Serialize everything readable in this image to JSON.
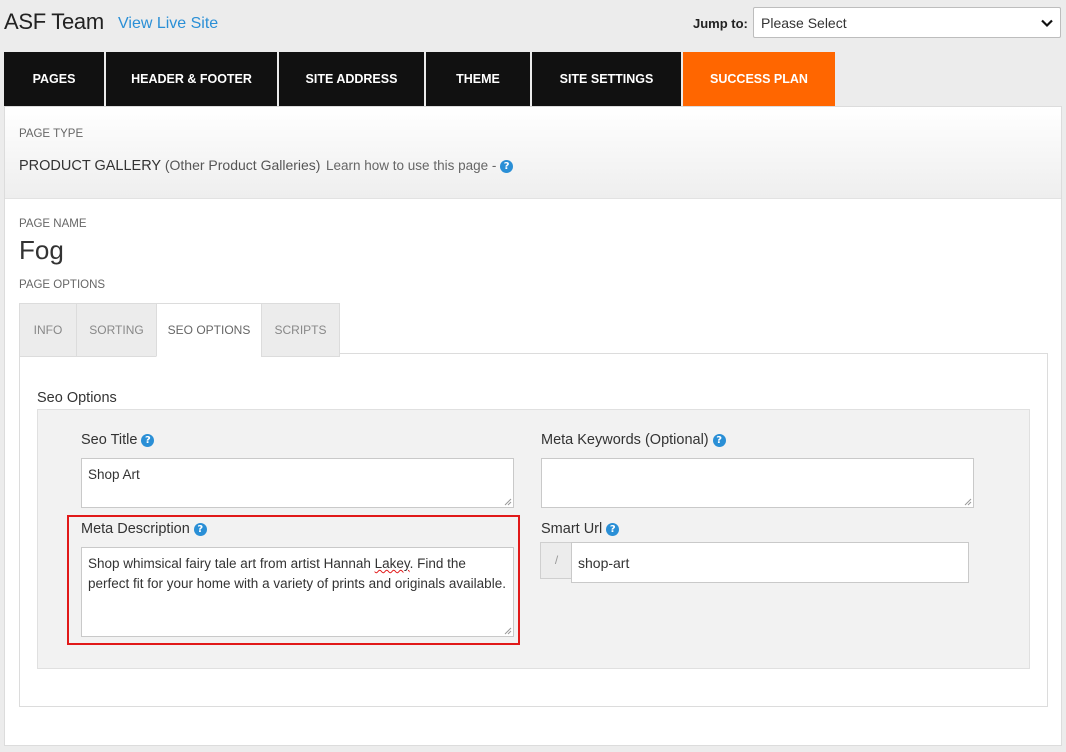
{
  "header": {
    "site_title": "ASF Team",
    "view_live_label": "View Live Site",
    "jump_label": "Jump to:",
    "jump_select_value": "Please Select"
  },
  "nav": {
    "tabs": [
      {
        "label": "PAGES"
      },
      {
        "label": "HEADER & FOOTER"
      },
      {
        "label": "SITE ADDRESS"
      },
      {
        "label": "THEME"
      },
      {
        "label": "SITE SETTINGS"
      },
      {
        "label": "SUCCESS PLAN"
      }
    ],
    "accent_color": "#ff6600"
  },
  "page_type": {
    "label": "PAGE TYPE",
    "value": "PRODUCT GALLERY",
    "sub_value": "(Other Product Galleries)",
    "learn_text": "Learn how to use this page -"
  },
  "page_name": {
    "label": "PAGE NAME",
    "value": "Fog"
  },
  "page_options": {
    "label": "PAGE OPTIONS",
    "tabs": [
      {
        "label": "INFO"
      },
      {
        "label": "SORTING"
      },
      {
        "label": "SEO OPTIONS"
      },
      {
        "label": "SCRIPTS"
      }
    ],
    "active_tab": "SEO OPTIONS"
  },
  "seo": {
    "section_title": "Seo Options",
    "seo_title_label": "Seo Title",
    "seo_title_value": "Shop Art",
    "meta_keywords_label": "Meta Keywords (Optional)",
    "meta_keywords_value": "",
    "meta_description_label": "Meta Description",
    "meta_description_value_before": "Shop whimsical fairy tale art from artist Hannah ",
    "meta_description_misspelled": "Lakey",
    "meta_description_value_after": ". Find the perfect fit for your home with a variety of prints and originals available.",
    "smart_url_label": "Smart Url",
    "smart_url_prefix": "/",
    "smart_url_value": "shop-art"
  },
  "icons": {
    "help": "help-question-icon",
    "dropdown": "chevron-down-icon"
  }
}
